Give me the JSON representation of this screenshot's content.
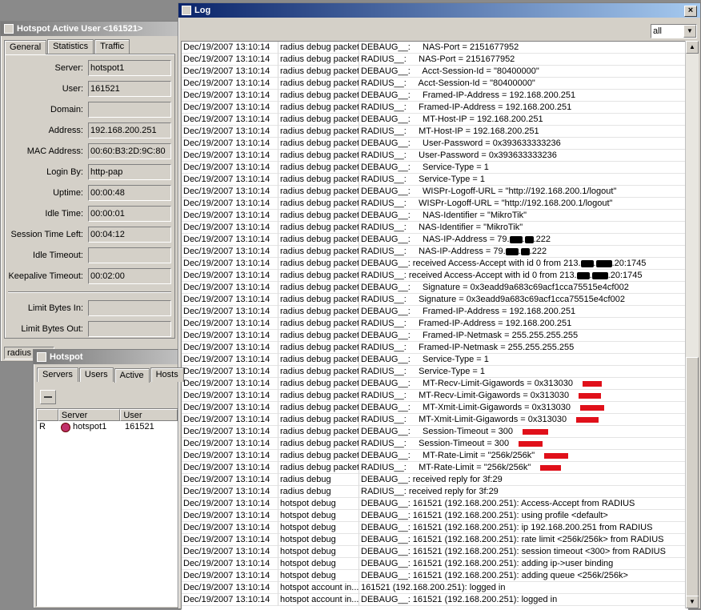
{
  "active_user_window": {
    "title": "Hotspot Active User <161521>",
    "tabs": [
      "General",
      "Statistics",
      "Traffic"
    ],
    "fields": [
      {
        "label": "Server:",
        "value": "hotspot1"
      },
      {
        "label": "User:",
        "value": "161521"
      },
      {
        "label": "Domain:",
        "value": ""
      },
      {
        "label": "Address:",
        "value": "192.168.200.251"
      },
      {
        "label": "MAC Address:",
        "value": "00:60:B3:2D:9C:80"
      },
      {
        "label": "Login By:",
        "value": "http-pap"
      },
      {
        "label": "Uptime:",
        "value": "00:00:48"
      },
      {
        "label": "Idle Time:",
        "value": "00:00:01"
      },
      {
        "label": "Session Time Left:",
        "value": "00:04:12"
      },
      {
        "label": "Idle Timeout:",
        "value": ""
      },
      {
        "label": "Keepalive Timeout:",
        "value": "00:02:00"
      }
    ],
    "limit_fields": [
      {
        "label": "Limit Bytes In:",
        "value": ""
      },
      {
        "label": "Limit Bytes Out:",
        "value": ""
      }
    ],
    "status_text": "radius"
  },
  "hotspot_window": {
    "title": "Hotspot",
    "tabs": [
      "Servers",
      "Users",
      "Active",
      "Hosts"
    ],
    "columns": [
      "",
      "Server",
      "User"
    ],
    "rows": [
      {
        "flag": "R",
        "server": "hotspot1",
        "user": "161521"
      }
    ]
  },
  "log_window": {
    "title": "Log",
    "filter_value": "all",
    "rows": [
      {
        "time": "Dec/19/2007 13:10:14",
        "topic": "radius debug packet",
        "msg": "DEBAUG__:     NAS-Port = 2151677952"
      },
      {
        "time": "Dec/19/2007 13:10:14",
        "topic": "radius debug packet",
        "msg": "RADIUS__:     NAS-Port = 2151677952"
      },
      {
        "time": "Dec/19/2007 13:10:14",
        "topic": "radius debug packet",
        "msg": "DEBAUG__:     Acct-Session-Id = \"80400000\""
      },
      {
        "time": "Dec/19/2007 13:10:14",
        "topic": "radius debug packet",
        "msg": "RADIUS__:     Acct-Session-Id = \"80400000\""
      },
      {
        "time": "Dec/19/2007 13:10:14",
        "topic": "radius debug packet",
        "msg": "DEBAUG__:     Framed-IP-Address = 192.168.200.251"
      },
      {
        "time": "Dec/19/2007 13:10:14",
        "topic": "radius debug packet",
        "msg": "RADIUS__:     Framed-IP-Address = 192.168.200.251"
      },
      {
        "time": "Dec/19/2007 13:10:14",
        "topic": "radius debug packet",
        "msg": "DEBAUG__:     MT-Host-IP = 192.168.200.251"
      },
      {
        "time": "Dec/19/2007 13:10:14",
        "topic": "radius debug packet",
        "msg": "RADIUS__:     MT-Host-IP = 192.168.200.251"
      },
      {
        "time": "Dec/19/2007 13:10:14",
        "topic": "radius debug packet",
        "msg": "DEBAUG__:     User-Password = 0x393633333236"
      },
      {
        "time": "Dec/19/2007 13:10:14",
        "topic": "radius debug packet",
        "msg": "RADIUS__:     User-Password = 0x393633333236"
      },
      {
        "time": "Dec/19/2007 13:10:14",
        "topic": "radius debug packet",
        "msg": "DEBAUG__:     Service-Type = 1"
      },
      {
        "time": "Dec/19/2007 13:10:14",
        "topic": "radius debug packet",
        "msg": "RADIUS__:     Service-Type = 1"
      },
      {
        "time": "Dec/19/2007 13:10:14",
        "topic": "radius debug packet",
        "msg": "DEBAUG__:     WISPr-Logoff-URL = \"http://192.168.200.1/logout\""
      },
      {
        "time": "Dec/19/2007 13:10:14",
        "topic": "radius debug packet",
        "msg": "RADIUS__:     WISPr-Logoff-URL = \"http://192.168.200.1/logout\""
      },
      {
        "time": "Dec/19/2007 13:10:14",
        "topic": "radius debug packet",
        "msg": "DEBAUG__:     NAS-Identifier = \"MikroTik\""
      },
      {
        "time": "Dec/19/2007 13:10:14",
        "topic": "radius debug packet",
        "msg": "RADIUS__:     NAS-Identifier = \"MikroTik\""
      },
      {
        "time": "Dec/19/2007 13:10:14",
        "topic": "radius debug packet",
        "msg": "DEBAUG__:     NAS-IP-Address = 79.",
        "redact": "ip"
      },
      {
        "time": "Dec/19/2007 13:10:14",
        "topic": "radius debug packet",
        "msg": "RADIUS__:     NAS-IP-Address = 79.",
        "redact": "ip"
      },
      {
        "time": "Dec/19/2007 13:10:14",
        "topic": "radius debug packet",
        "msg": "DEBAUG__: received Access-Accept with id 0 from 213.",
        "redact": "port"
      },
      {
        "time": "Dec/19/2007 13:10:14",
        "topic": "radius debug packet",
        "msg": "RADIUS__: received Access-Accept with id 0 from 213.",
        "redact": "port"
      },
      {
        "time": "Dec/19/2007 13:10:14",
        "topic": "radius debug packet",
        "msg": "DEBAUG__:     Signature = 0x3eadd9a683c69acf1cca75515e4cf002"
      },
      {
        "time": "Dec/19/2007 13:10:14",
        "topic": "radius debug packet",
        "msg": "RADIUS__:     Signature = 0x3eadd9a683c69acf1cca75515e4cf002"
      },
      {
        "time": "Dec/19/2007 13:10:14",
        "topic": "radius debug packet",
        "msg": "DEBAUG__:     Framed-IP-Address = 192.168.200.251"
      },
      {
        "time": "Dec/19/2007 13:10:14",
        "topic": "radius debug packet",
        "msg": "RADIUS__:     Framed-IP-Address = 192.168.200.251"
      },
      {
        "time": "Dec/19/2007 13:10:14",
        "topic": "radius debug packet",
        "msg": "DEBAUG__:     Framed-IP-Netmask = 255.255.255.255"
      },
      {
        "time": "Dec/19/2007 13:10:14",
        "topic": "radius debug packet",
        "msg": "RADIUS__:     Framed-IP-Netmask = 255.255.255.255"
      },
      {
        "time": "Dec/19/2007 13:10:14",
        "topic": "radius debug packet",
        "msg": "DEBAUG__:     Service-Type = 1"
      },
      {
        "time": "Dec/19/2007 13:10:14",
        "topic": "radius debug packet",
        "msg": "RADIUS__:     Service-Type = 1"
      },
      {
        "time": "Dec/19/2007 13:10:14",
        "topic": "radius debug packet",
        "msg": "DEBAUG__:     MT-Recv-Limit-Gigawords = 0x313030",
        "redact": "red"
      },
      {
        "time": "Dec/19/2007 13:10:14",
        "topic": "radius debug packet",
        "msg": "RADIUS__:     MT-Recv-Limit-Gigawords = 0x313030",
        "redact": "red"
      },
      {
        "time": "Dec/19/2007 13:10:14",
        "topic": "radius debug packet",
        "msg": "DEBAUG__:     MT-Xmit-Limit-Gigawords = 0x313030",
        "redact": "red"
      },
      {
        "time": "Dec/19/2007 13:10:14",
        "topic": "radius debug packet",
        "msg": "RADIUS__:     MT-Xmit-Limit-Gigawords = 0x313030",
        "redact": "red"
      },
      {
        "time": "Dec/19/2007 13:10:14",
        "topic": "radius debug packet",
        "msg": "DEBAUG__:     Session-Timeout = 300",
        "redact": "red"
      },
      {
        "time": "Dec/19/2007 13:10:14",
        "topic": "radius debug packet",
        "msg": "RADIUS__:     Session-Timeout = 300",
        "redact": "red"
      },
      {
        "time": "Dec/19/2007 13:10:14",
        "topic": "radius debug packet",
        "msg": "DEBAUG__:     MT-Rate-Limit = \"256k/256k\"",
        "redact": "red"
      },
      {
        "time": "Dec/19/2007 13:10:14",
        "topic": "radius debug packet",
        "msg": "RADIUS__:     MT-Rate-Limit = \"256k/256k\"",
        "redact": "red"
      },
      {
        "time": "Dec/19/2007 13:10:14",
        "topic": "radius debug",
        "msg": "DEBAUG__: received reply for 3f:29"
      },
      {
        "time": "Dec/19/2007 13:10:14",
        "topic": "radius debug",
        "msg": "RADIUS__: received reply for 3f:29"
      },
      {
        "time": "Dec/19/2007 13:10:14",
        "topic": "hotspot debug",
        "msg": "DEBAUG__: 161521 (192.168.200.251): Access-Accept from RADIUS"
      },
      {
        "time": "Dec/19/2007 13:10:14",
        "topic": "hotspot debug",
        "msg": "DEBAUG__: 161521 (192.168.200.251): using profile <default>"
      },
      {
        "time": "Dec/19/2007 13:10:14",
        "topic": "hotspot debug",
        "msg": "DEBAUG__: 161521 (192.168.200.251): ip 192.168.200.251 from RADIUS"
      },
      {
        "time": "Dec/19/2007 13:10:14",
        "topic": "hotspot debug",
        "msg": "DEBAUG__: 161521 (192.168.200.251): rate limit <256k/256k> from RADIUS"
      },
      {
        "time": "Dec/19/2007 13:10:14",
        "topic": "hotspot debug",
        "msg": "DEBAUG__: 161521 (192.168.200.251): session timeout <300> from RADIUS"
      },
      {
        "time": "Dec/19/2007 13:10:14",
        "topic": "hotspot debug",
        "msg": "DEBAUG__: 161521 (192.168.200.251): adding ip->user binding"
      },
      {
        "time": "Dec/19/2007 13:10:14",
        "topic": "hotspot debug",
        "msg": "DEBAUG__: 161521 (192.168.200.251): adding queue <256k/256k>"
      },
      {
        "time": "Dec/19/2007 13:10:14",
        "topic": "hotspot account in...",
        "msg": "161521 (192.168.200.251): logged in"
      },
      {
        "time": "Dec/19/2007 13:10:14",
        "topic": "hotspot account in...",
        "msg": "DEBAUG__: 161521 (192.168.200.251): logged in"
      }
    ],
    "ip_tail": ".222",
    "port_tail": ".20:1745"
  },
  "colors": {
    "title_active": "#0a246a",
    "title_inactive": "#7a7a7a",
    "redaction": "#e0101a"
  }
}
